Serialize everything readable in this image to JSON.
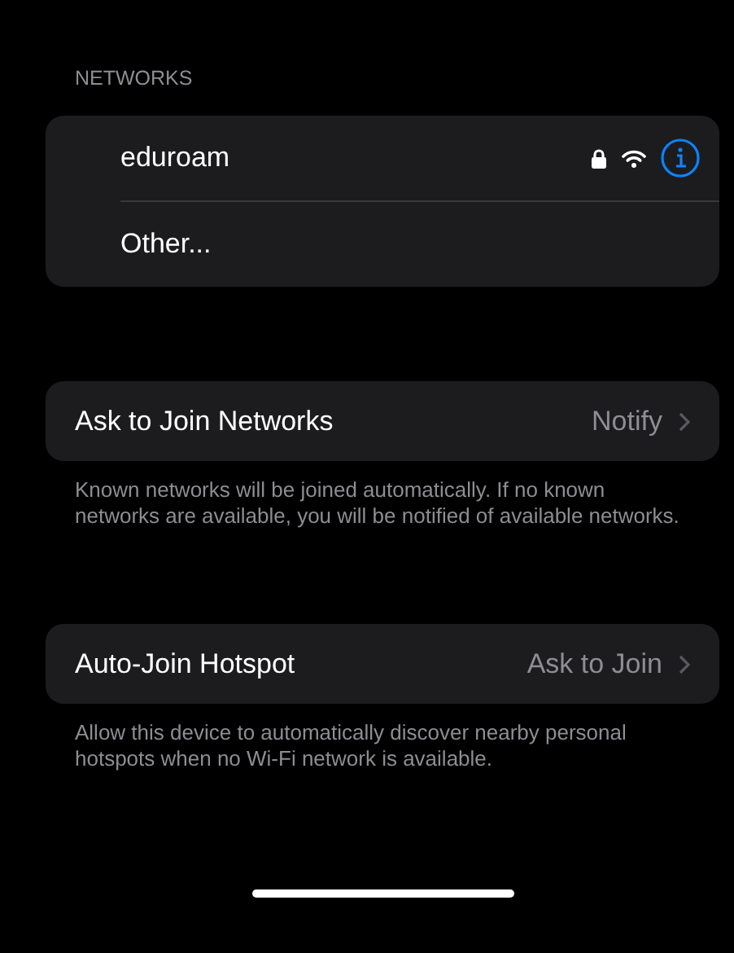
{
  "networks_section": {
    "header": "NETWORKS",
    "items": [
      {
        "kind": "network",
        "name": "eduroam",
        "secured": true
      },
      {
        "kind": "other",
        "name": "Other..."
      }
    ]
  },
  "settings": [
    {
      "label": "Ask to Join Networks",
      "value": "Notify",
      "footer": "Known networks will be joined automatically. If no known networks are available, you will be notified of available networks."
    },
    {
      "label": "Auto-Join Hotspot",
      "value": "Ask to Join",
      "footer": "Allow this device to automatically discover nearby personal hotspots when no Wi-Fi network is available."
    }
  ]
}
